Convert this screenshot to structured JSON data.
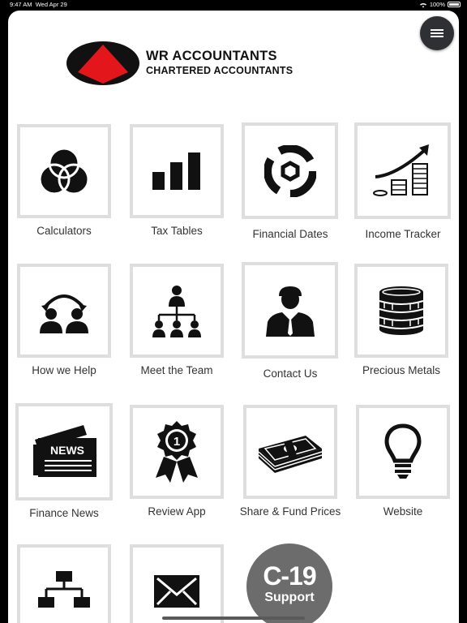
{
  "status_bar": {
    "time": "9:47 AM",
    "date": "Wed Apr 29",
    "battery": "100%"
  },
  "header": {
    "brand_name": "WR ACCOUNTANTS",
    "brand_sub": "CHARTERED ACCOUNTANTS",
    "logo_colors": {
      "red": "#e3161b",
      "black": "#111111"
    }
  },
  "tiles": [
    {
      "label": "Calculators",
      "icon": "venn-circles-icon"
    },
    {
      "label": "Tax Tables",
      "icon": "bar-chart-icon"
    },
    {
      "label": "Financial Dates",
      "icon": "cycle-icon"
    },
    {
      "label": "Income Tracker",
      "icon": "growth-coins-icon"
    },
    {
      "label": "How we Help",
      "icon": "people-exchange-icon"
    },
    {
      "label": "Meet the Team",
      "icon": "org-team-icon"
    },
    {
      "label": "Contact Us",
      "icon": "businessman-icon"
    },
    {
      "label": "Precious Metals",
      "icon": "coin-stack-icon"
    },
    {
      "label": "Finance News",
      "icon": "newspaper-icon"
    },
    {
      "label": "Review App",
      "icon": "award-ribbon-icon"
    },
    {
      "label": "Share & Fund Prices",
      "icon": "cash-stack-icon"
    },
    {
      "label": "Website",
      "icon": "lightbulb-icon"
    },
    {
      "label": "",
      "icon": "sitemap-icon"
    },
    {
      "label": "",
      "icon": "envelope-icon"
    }
  ],
  "covid_button": {
    "title": "C-19",
    "subtitle": "Support"
  }
}
